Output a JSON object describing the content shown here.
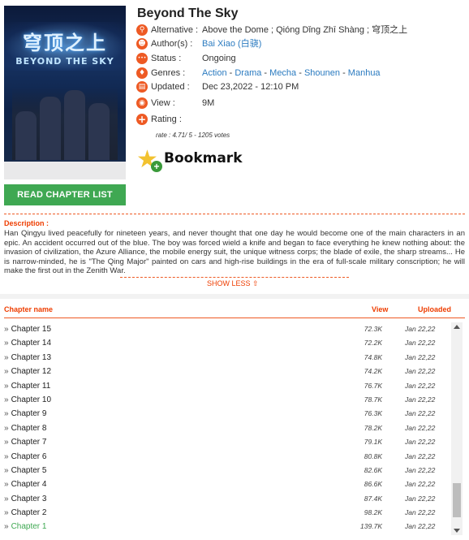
{
  "manga": {
    "title": "Beyond The Sky",
    "cover_title": "穹顶之上",
    "cover_subtitle": "BEYOND THE SKY",
    "read_button": "READ CHAPTER LIST",
    "info": [
      {
        "icon": "alternative-icon",
        "glyph": "⚲",
        "label": "Alternative :",
        "value": "Above the Dome ; Qióng Dǐng Zhī Shàng ; 穹顶之上",
        "links": []
      },
      {
        "icon": "author-icon",
        "glyph": "☻",
        "label": "Author(s) :",
        "value": "",
        "links": [
          "Bai Xiao (白骁)"
        ]
      },
      {
        "icon": "status-icon",
        "glyph": "•••",
        "label": "Status :",
        "value": "Ongoing",
        "links": []
      },
      {
        "icon": "genres-icon",
        "glyph": "♦",
        "label": "Genres :",
        "value": "",
        "links": [
          "Action",
          "Drama",
          "Mecha",
          "Shounen",
          "Manhua"
        ]
      },
      {
        "icon": "updated-icon",
        "glyph": "▤",
        "label": "Updated :",
        "value": "Dec 23,2022 - 12:10 PM",
        "links": []
      },
      {
        "icon": "view-icon",
        "glyph": "◉",
        "label": "View :",
        "value": "9M",
        "links": []
      },
      {
        "icon": "rating-icon",
        "glyph": "+",
        "label": "Rating :",
        "value": "",
        "links": []
      }
    ],
    "rating_text": "rate : 4.71/ 5 - 1205 votes",
    "rating_value": 4.71,
    "bookmark_label": "Bookmark"
  },
  "description": {
    "heading": "Description :",
    "text": "Han Qingyu lived peacefully for nineteen years, and never thought that one day he would become one of the main characters in an epic. An accident occurred out of the blue. The boy was forced wield a knife and began to face everything he knew nothing about: the invasion of civilization, the Azure Alliance, the mobile energy suit, the unique witness corps; the blade of exile, the sharp streams... He is narrow-minded, he is \"The Qing Major\" painted on cars and high-rise buildings in the era of full-scale military conscription; he will make the first out in the Zenith War.",
    "show_less": "SHOW LESS ⇧"
  },
  "chapter_list": {
    "headers": {
      "name": "Chapter name",
      "view": "View",
      "uploaded": "Uploaded"
    },
    "chapters": [
      {
        "name": "Chapter 15",
        "views": "72.3K",
        "uploaded": "Jan 22,22"
      },
      {
        "name": "Chapter 14",
        "views": "72.2K",
        "uploaded": "Jan 22,22"
      },
      {
        "name": "Chapter 13",
        "views": "74.8K",
        "uploaded": "Jan 22,22"
      },
      {
        "name": "Chapter 12",
        "views": "74.2K",
        "uploaded": "Jan 22,22"
      },
      {
        "name": "Chapter 11",
        "views": "76.7K",
        "uploaded": "Jan 22,22"
      },
      {
        "name": "Chapter 10",
        "views": "78.7K",
        "uploaded": "Jan 22,22"
      },
      {
        "name": "Chapter 9",
        "views": "76.3K",
        "uploaded": "Jan 22,22"
      },
      {
        "name": "Chapter 8",
        "views": "78.2K",
        "uploaded": "Jan 22,22"
      },
      {
        "name": "Chapter 7",
        "views": "79.1K",
        "uploaded": "Jan 22,22"
      },
      {
        "name": "Chapter 6",
        "views": "80.8K",
        "uploaded": "Jan 22,22"
      },
      {
        "name": "Chapter 5",
        "views": "82.6K",
        "uploaded": "Jan 22,22"
      },
      {
        "name": "Chapter 4",
        "views": "86.6K",
        "uploaded": "Jan 22,22"
      },
      {
        "name": "Chapter 3",
        "views": "87.4K",
        "uploaded": "Jan 22,22"
      },
      {
        "name": "Chapter 2",
        "views": "98.2K",
        "uploaded": "Jan 22,22"
      },
      {
        "name": "Chapter 1",
        "views": "139.7K",
        "uploaded": "Jan 22,22",
        "active": true
      }
    ]
  },
  "colors": {
    "accent": "#ee5a24",
    "link": "#2b7bc0",
    "button": "#3fa852",
    "active_chapter": "#3fa852"
  }
}
